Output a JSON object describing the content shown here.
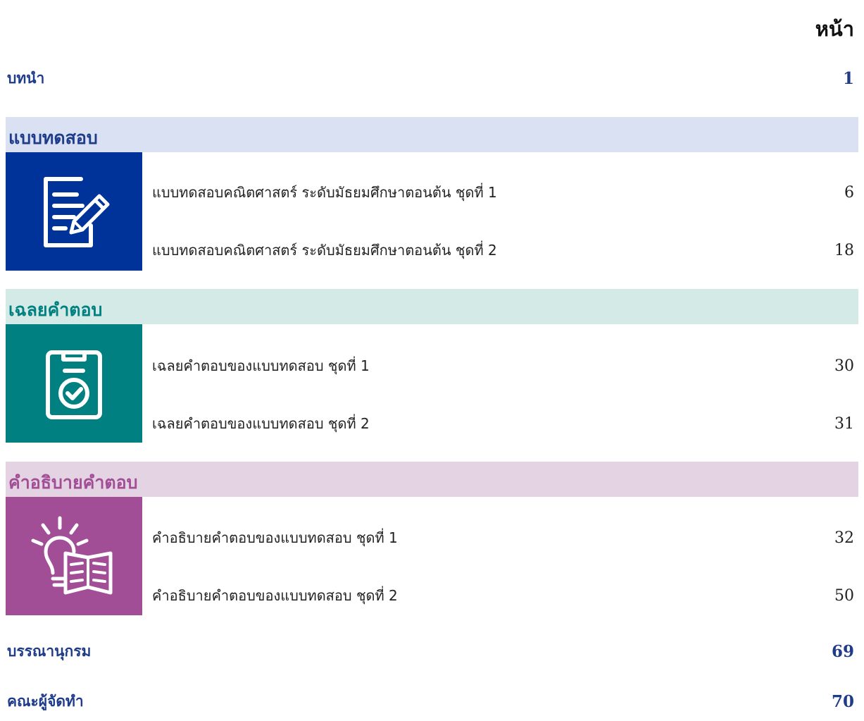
{
  "header": {
    "page_label": "หน้า"
  },
  "intro": {
    "label": "บทนำ",
    "page": "1"
  },
  "colors": {
    "accent_navy": "#1f3c8a",
    "test_band": "#d9e1f2",
    "test_box": "#00339a",
    "answer_band": "#d4eae7",
    "answer_box": "#008080",
    "explain_band": "#e4d3e2",
    "explain_box": "#a24e96",
    "explain_text": "#a24e96"
  },
  "sections": [
    {
      "title": "แบบทดสอบ",
      "icon": "test-paper-pencil-icon",
      "entries": [
        {
          "label": "แบบทดสอบคณิตศาสตร์ ระดับมัธยมศึกษาตอนต้น ชุดที่ 1",
          "page": "6"
        },
        {
          "label": "แบบทดสอบคณิตศาสตร์ ระดับมัธยมศึกษาตอนต้น ชุดที่ 2",
          "page": "18"
        }
      ]
    },
    {
      "title": "เฉลยคำตอบ",
      "icon": "clipboard-check-icon",
      "entries": [
        {
          "label": "เฉลยคำตอบของแบบทดสอบ ชุดที่ 1",
          "page": "30"
        },
        {
          "label": "เฉลยคำตอบของแบบทดสอบ ชุดที่ 2",
          "page": "31"
        }
      ]
    },
    {
      "title": "คำอธิบายคำตอบ",
      "icon": "lightbulb-book-icon",
      "entries": [
        {
          "label": "คำอธิบายคำตอบของแบบทดสอบ ชุดที่ 1",
          "page": "32"
        },
        {
          "label": "คำอธิบายคำตอบของแบบทดสอบ ชุดที่ 2",
          "page": "50"
        }
      ]
    }
  ],
  "bibliography": {
    "label": "บรรณานุกรม",
    "page": "69"
  },
  "authors": {
    "label": "คณะผู้จัดทำ",
    "page": "70"
  }
}
